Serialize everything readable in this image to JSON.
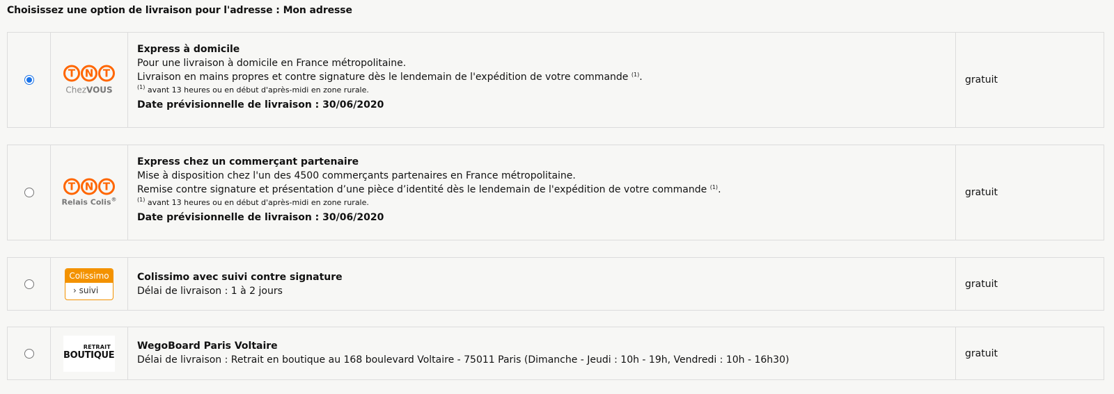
{
  "heading": "Choisissez une option de livraison pour l'adresse : Mon adresse",
  "options": [
    {
      "selected": true,
      "logo": {
        "letters": [
          "T",
          "N",
          "T"
        ],
        "name_prefix": "Chez",
        "name_suffix": "VOUS"
      },
      "title": "Express à domicile",
      "line1": "Pour une livraison à domicile en France métropolitaine.",
      "line2": "Livraison en mains propres et contre signature dès le lendemain de l'expédition de votre commande",
      "footnote_marker": "(1)",
      "footnote_suffix": ".",
      "footnote": "avant 13 heures ou en début d'après-midi en zone rurale.",
      "date": "Date prévisionnelle de livraison : 30/06/2020",
      "price": "gratuit"
    },
    {
      "selected": false,
      "logo": {
        "letters": [
          "T",
          "N",
          "T"
        ],
        "name": "Relais Colis",
        "mark": "®"
      },
      "title": "Express chez un commerçant partenaire",
      "line1": "Mise à disposition chez l'un des 4500 commerçants partenaires en France métropolitaine.",
      "line2": "Remise contre signature et présentation d’une pièce d’identité dès le lendemain de l'expédition de votre commande",
      "footnote_marker": "(1)",
      "footnote_suffix": ".",
      "footnote": "avant 13 heures ou en début d'après-midi en zone rurale.",
      "date": "Date prévisionnelle de livraison : 30/06/2020",
      "price": "gratuit"
    },
    {
      "selected": false,
      "logo": {
        "top": "Colissimo",
        "bottom": "› suivi"
      },
      "title": "Colissimo avec suivi contre signature",
      "line1": "Délai de livraison : 1 à 2 jours",
      "price": "gratuit"
    },
    {
      "selected": false,
      "logo": {
        "small": "RETRAIT",
        "big": "BOUTIQUE"
      },
      "title": "WegoBoard Paris Voltaire",
      "line1": "Délai de livraison : Retrait en boutique au 168 boulevard Voltaire - 75011 Paris (Dimanche - Jeudi : 10h - 19h, Vendredi : 10h - 16h30)",
      "price": "gratuit"
    }
  ],
  "colors": {
    "tnt_orange": "#ff6600",
    "colissimo_orange": "#f39200",
    "radio_blue": "#1a73e8",
    "border": "#dcdcdc",
    "background": "#f7f7f5"
  },
  "icons": {
    "option_1_logo": "tnt-chezvous-logo",
    "option_2_logo": "tnt-relais-colis-logo",
    "option_3_logo": "colissimo-suivi-logo",
    "option_4_logo": "retrait-boutique-logo"
  }
}
